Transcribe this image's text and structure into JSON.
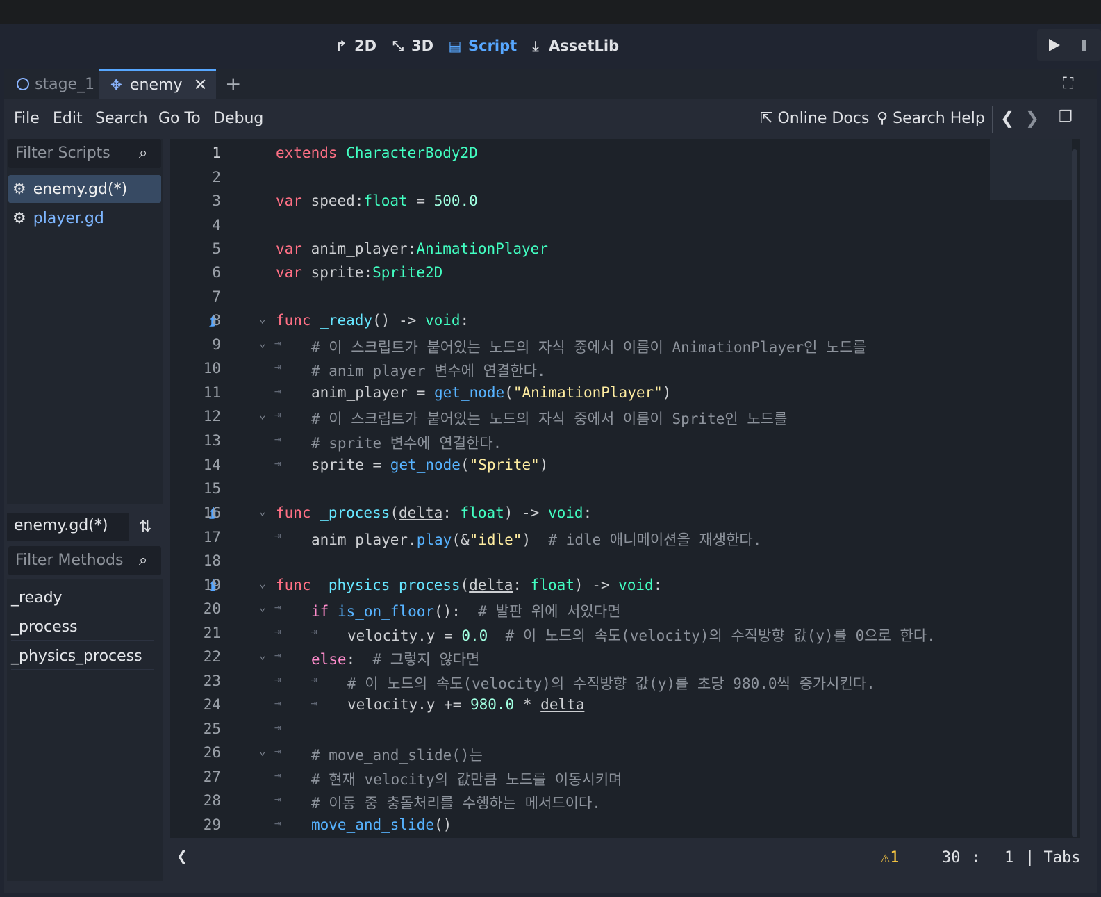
{
  "workspaces": {
    "d2": "2D",
    "d3": "3D",
    "script": "Script",
    "assetlib": "AssetLib"
  },
  "tabs": {
    "stage": "stage_1",
    "enemy": "enemy"
  },
  "menu": {
    "file": "File",
    "edit": "Edit",
    "search": "Search",
    "goto": "Go To",
    "debug": "Debug"
  },
  "help": {
    "online_docs": "Online Docs",
    "search_help": "Search Help"
  },
  "scripts": {
    "filter_placeholder": "Filter Scripts",
    "items": [
      "enemy.gd(*)",
      "player.gd"
    ]
  },
  "methods": {
    "current_script": "enemy.gd(*)",
    "filter_placeholder": "Filter Methods",
    "items": [
      "_ready",
      "_process",
      "_physics_process"
    ]
  },
  "code": {
    "line_numbers": [
      "1",
      "2",
      "3",
      "4",
      "5",
      "6",
      "7",
      "8",
      "9",
      "10",
      "11",
      "12",
      "13",
      "14",
      "15",
      "16",
      "17",
      "18",
      "19",
      "20",
      "21",
      "22",
      "23",
      "24",
      "25",
      "26",
      "27",
      "28",
      "29"
    ],
    "l1a": "extends",
    "l1b": "CharacterBody2D",
    "l3a": "var",
    "l3b": " speed:",
    "l3c": "float",
    "l3d": " = ",
    "l3e": "500.0",
    "l5a": "var",
    "l5b": " anim_player:",
    "l5c": "AnimationPlayer",
    "l6a": "var",
    "l6b": " sprite:",
    "l6c": "Sprite2D",
    "l8a": "func",
    "l8b": " _ready",
    "l8c": "() -> ",
    "l8d": "void",
    "l9": "# 이 스크립트가 붙어있는 노드의 자식 중에서 이름이 AnimationPlayer인 노드를",
    "l10": "# anim_player 변수에 연결한다.",
    "l11a": "anim_player = ",
    "l11b": "get_node",
    "l11c": "(",
    "l11d": "\"AnimationPlayer\"",
    "l11e": ")",
    "l12": "# 이 스크립트가 붙어있는 노드의 자식 중에서 이름이 Sprite인 노드를",
    "l13": "# sprite 변수에 연결한다.",
    "l14a": "sprite = ",
    "l14b": "get_node",
    "l14c": "(",
    "l14d": "\"Sprite\"",
    "l14e": ")",
    "l16a": "func",
    "l16b": " _process",
    "l16c": "(",
    "l16d": "delta",
    "l16e": ": ",
    "l16f": "float",
    "l16g": ") -> ",
    "l16h": "void",
    "l17a": "anim_player.",
    "l17b": "play",
    "l17c": "(&",
    "l17d": "\"idle\"",
    "l17e": ")  ",
    "l17f": "# idle 애니메이션을 재생한다.",
    "l19a": "func",
    "l19b": " _physics_process",
    "l19c": "(",
    "l19d": "delta",
    "l19e": ": ",
    "l19f": "float",
    "l19g": ") -> ",
    "l19h": "void",
    "l20a": "if",
    "l20b": " is_on_floor",
    "l20c": "():  ",
    "l20d": "# 발판 위에 서있다면",
    "l21a": "velocity.y = ",
    "l21b": "0.0",
    "l21c": "  # 이 노드의 속도(velocity)의 수직방향 값(y)를 0으로 한다.",
    "l22a": "else",
    "l22b": ":  ",
    "l22c": "# 그렇지 않다면",
    "l23": "# 이 노드의 속도(velocity)의 수직방향 값(y)를 초당 980.0씩 증가시킨다.",
    "l24a": "velocity.y += ",
    "l24b": "980.0",
    "l24c": " * ",
    "l24d": "delta",
    "l26": "# move_and_slide()는",
    "l27": "# 현재 velocity의 값만큼 노드를 이동시키며",
    "l28": "# 이동 중 충돌처리를 수행하는 메서드이다.",
    "l29a": "move_and_slide",
    "l29b": "()"
  },
  "status": {
    "warnings": "1",
    "line": "30",
    "colon": ":",
    "col": "1",
    "indent": "| Tabs"
  },
  "colors": {
    "accent": "#57a7ff",
    "keyword": "#ff7085",
    "type": "#42ffc2",
    "function": "#57b3ff",
    "string": "#ffeda1",
    "comment": "#8d939c",
    "warning": "#ffcc42"
  },
  "icons": [
    "2d-icon",
    "3d-icon",
    "script-icon",
    "assetlib-icon",
    "play-icon",
    "node-icon",
    "enemy-scene-icon",
    "close-icon",
    "add-tab-icon",
    "fullscreen-icon",
    "external-link-icon",
    "help-search-icon",
    "back-icon",
    "forward-icon",
    "distraction-free-icon",
    "search-icon",
    "gear-icon",
    "sort-icon",
    "bookmark-icon",
    "fold-icon",
    "warning-icon"
  ]
}
